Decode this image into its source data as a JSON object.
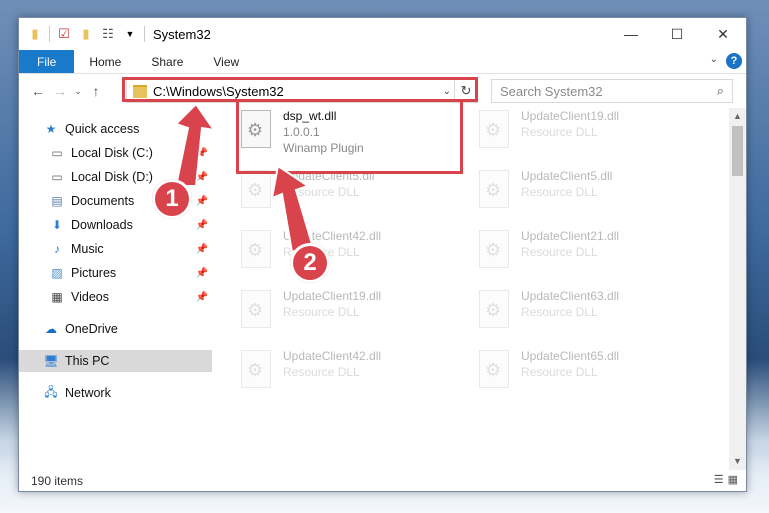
{
  "window": {
    "title": "System32",
    "controls": {
      "minimize": "—",
      "maximize": "☐",
      "close": "✕"
    }
  },
  "ribbon": {
    "tabs": [
      "File",
      "Home",
      "Share",
      "View"
    ],
    "help": "?"
  },
  "address": {
    "path": "C:\\Windows\\System32"
  },
  "search": {
    "placeholder": "Search System32"
  },
  "nav": {
    "items": [
      {
        "label": "Quick access",
        "icon": "star-icon"
      },
      {
        "label": "Local Disk (C:)",
        "icon": "drive-icon",
        "pinned": true
      },
      {
        "label": "Local Disk (D:)",
        "icon": "drive-icon",
        "pinned": true
      },
      {
        "label": "Documents",
        "icon": "documents-icon",
        "pinned": true
      },
      {
        "label": "Downloads",
        "icon": "download-icon",
        "pinned": true
      },
      {
        "label": "Music",
        "icon": "music-icon",
        "pinned": true
      },
      {
        "label": "Pictures",
        "icon": "pictures-icon",
        "pinned": true
      },
      {
        "label": "Videos",
        "icon": "videos-icon",
        "pinned": true
      },
      {
        "label": "OneDrive",
        "icon": "cloud-icon"
      },
      {
        "label": "This PC",
        "icon": "computer-icon",
        "selected": true
      },
      {
        "label": "Network",
        "icon": "network-icon"
      }
    ]
  },
  "files": [
    {
      "name": "dsp_wt.dll",
      "line2": "1.0.0.1",
      "line3": "Winamp Plugin"
    },
    {
      "name": "UpdateClient19.dll",
      "line2": "Resource DLL"
    },
    {
      "name": "UpdateClient5.dll",
      "line2": "Resource DLL"
    },
    {
      "name": "UpdateClient5.dll",
      "line2": "Resource DLL"
    },
    {
      "name": "UpdateClient42.dll",
      "line2": "Resource DLL"
    },
    {
      "name": "UpdateClient21.dll",
      "line2": "Resource DLL"
    },
    {
      "name": "UpdateClient19.dll",
      "line2": "Resource DLL"
    },
    {
      "name": "UpdateClient63.dll",
      "line2": "Resource DLL"
    },
    {
      "name": "UpdateClient42.dll",
      "line2": "Resource DLL"
    },
    {
      "name": "UpdateClient65.dll",
      "line2": "Resource DLL"
    }
  ],
  "status": {
    "count": "190 items"
  },
  "annotations": {
    "step1": "1",
    "step2": "2",
    "color": "#d9434b"
  }
}
